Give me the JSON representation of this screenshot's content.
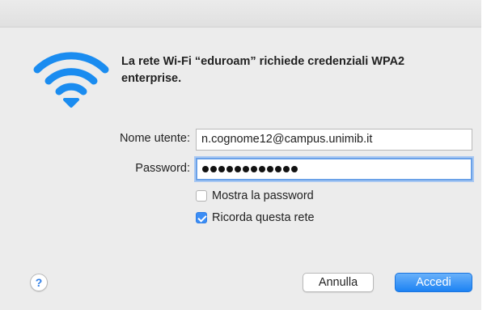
{
  "dialog": {
    "message": "La rete Wi-Fi “eduroam” richiede credenziali WPA2 enterprise.",
    "icon": "wifi-icon",
    "accent_color": "#1a8cf0"
  },
  "form": {
    "username_label": "Nome utente:",
    "username_value": "n.cognome12@campus.unimib.it",
    "password_label": "Password:",
    "password_length": 12,
    "show_password_label": "Mostra la password",
    "show_password_checked": false,
    "remember_network_label": "Ricorda questa rete",
    "remember_network_checked": true
  },
  "buttons": {
    "help_label": "?",
    "cancel_label": "Annulla",
    "connect_label": "Accedi"
  }
}
